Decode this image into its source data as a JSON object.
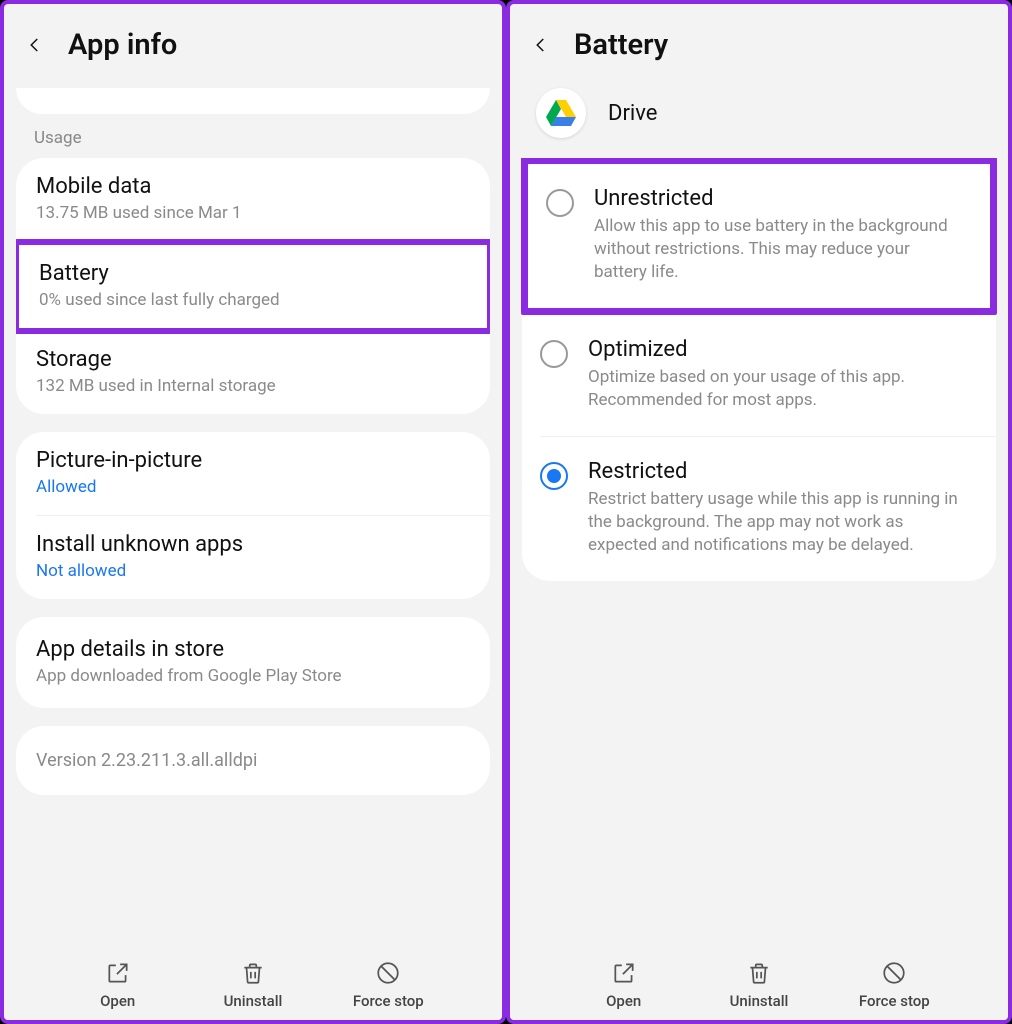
{
  "left": {
    "title": "App info",
    "section_label": "Usage",
    "usage": [
      {
        "title": "Mobile data",
        "sub": "13.75 MB used since Mar 1",
        "highlighted": false
      },
      {
        "title": "Battery",
        "sub": "0% used since last fully charged",
        "highlighted": true
      },
      {
        "title": "Storage",
        "sub": "132 MB used in Internal storage",
        "highlighted": false
      }
    ],
    "settings": [
      {
        "title": "Picture-in-picture",
        "sub": "Allowed",
        "link": true
      },
      {
        "title": "Install unknown apps",
        "sub": "Not allowed",
        "link": true
      }
    ],
    "details": {
      "title": "App details in store",
      "sub": "App downloaded from Google Play Store"
    },
    "version": "Version 2.23.211.3.all.alldpi"
  },
  "right": {
    "title": "Battery",
    "app_name": "Drive",
    "options": [
      {
        "title": "Unrestricted",
        "desc": "Allow this app to use battery in the background without restrictions. This may reduce your battery life.",
        "selected": false,
        "highlighted": true
      },
      {
        "title": "Optimized",
        "desc": "Optimize based on your usage of this app. Recommended for most apps.",
        "selected": false,
        "highlighted": false
      },
      {
        "title": "Restricted",
        "desc": "Restrict battery usage while this app is running in the background. The app may not work as expected and notifications may be delayed.",
        "selected": true,
        "highlighted": false
      }
    ]
  },
  "bottom": {
    "open": "Open",
    "uninstall": "Uninstall",
    "force_stop": "Force stop"
  }
}
